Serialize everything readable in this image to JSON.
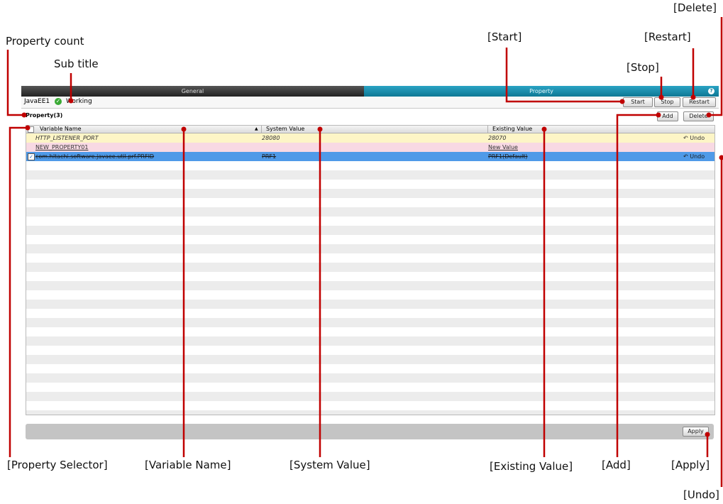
{
  "callouts": {
    "delete": "[Delete]",
    "property_count": "Property count",
    "start": "[Start]",
    "restart": "[Restart]",
    "sub_title": "Sub title",
    "stop": "[Stop]",
    "property_selector": "[Property Selector]",
    "variable_name": "[Variable Name]",
    "system_value": "[System Value]",
    "existing_value": "[Existing Value]",
    "add": "[Add]",
    "apply": "[Apply]",
    "undo": "[Undo]"
  },
  "tabs": {
    "general": "General",
    "property": "Property",
    "help": "?"
  },
  "subbar": {
    "server_name": "JavaEE1",
    "status": "Working",
    "start_label": "Start",
    "stop_label": "Stop",
    "restart_label": "Restart"
  },
  "property_panel": {
    "title": "Property(3)",
    "add_label": "Add",
    "delete_label": "Delete"
  },
  "grid": {
    "columns": [
      "Variable Name",
      "System Value",
      "Existing Value"
    ],
    "sort_indicator": "▲",
    "rows": [
      {
        "name": "HTTP_LISTENER_PORT",
        "system": "28080",
        "existing": "28070",
        "undo": "Undo",
        "color": "#fdf5c6"
      },
      {
        "name": "NEW_PROPERTY01",
        "system": "",
        "existing": "New Value",
        "undo": "",
        "color": "#f8d9e3"
      },
      {
        "name": "com.hitachi.software.javaee.util.prf.PRFID",
        "system": "PRF1",
        "existing": "PRF1(Default)",
        "undo": "Undo",
        "color": "#4f9ae8"
      }
    ]
  },
  "footer": {
    "apply_label": "Apply"
  },
  "colors": {
    "callout_line": "#c00000",
    "tab_active": "#1a90b1",
    "status_ok": "#3aaa35"
  }
}
